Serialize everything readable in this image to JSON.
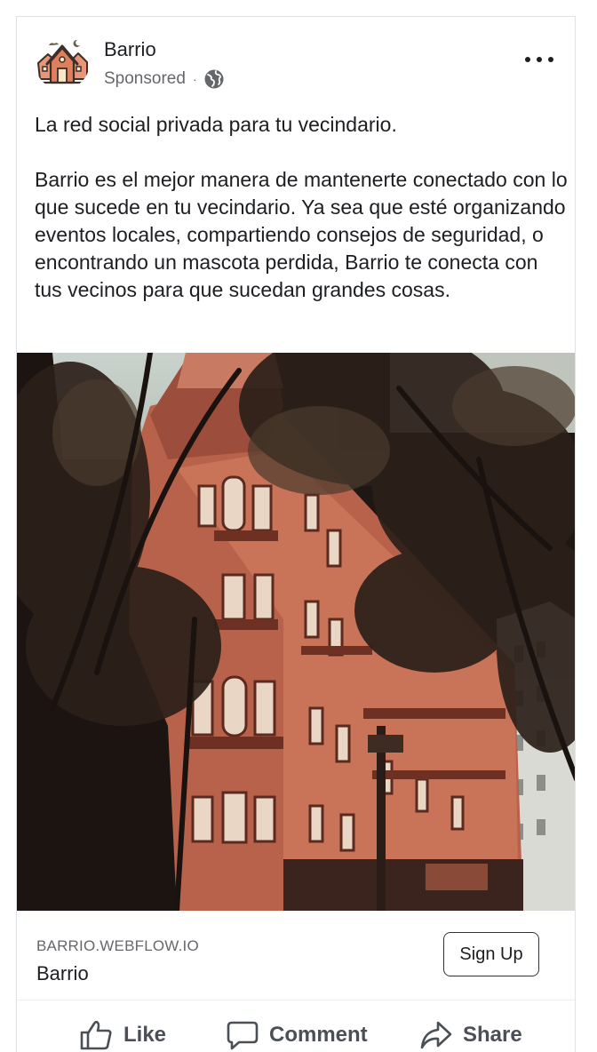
{
  "post": {
    "page_name": "Barrio",
    "sponsored_label": "Sponsored",
    "separator": "·",
    "audience_icon": "globe-icon",
    "more_icon": "more-horizontal-icon",
    "text_paragraphs": [
      "La red social privada para tu vecindario.",
      "Barrio es el mejor manera de mantenerte conectado con lo que sucede en tu vecindario. Ya sea que esté organizando eventos locales, compartiendo consejos de seguridad, o encontrando un mascota perdida, Barrio te conecta con tus vecinos para que sucedan grandes cosas."
    ]
  },
  "link_preview": {
    "domain": "BARRIO.WEBFLOW.IO",
    "title": "Barrio",
    "cta_label": "Sign Up"
  },
  "actions": {
    "like_label": "Like",
    "comment_label": "Comment",
    "share_label": "Share",
    "like_icon": "thumbs-up-icon",
    "comment_icon": "speech-bubble-icon",
    "share_icon": "share-arrow-icon"
  },
  "colors": {
    "text_primary": "#1c1e21",
    "text_secondary": "#65676b",
    "action_text": "#4b4f56",
    "brand_orange": "#e07f5b"
  }
}
